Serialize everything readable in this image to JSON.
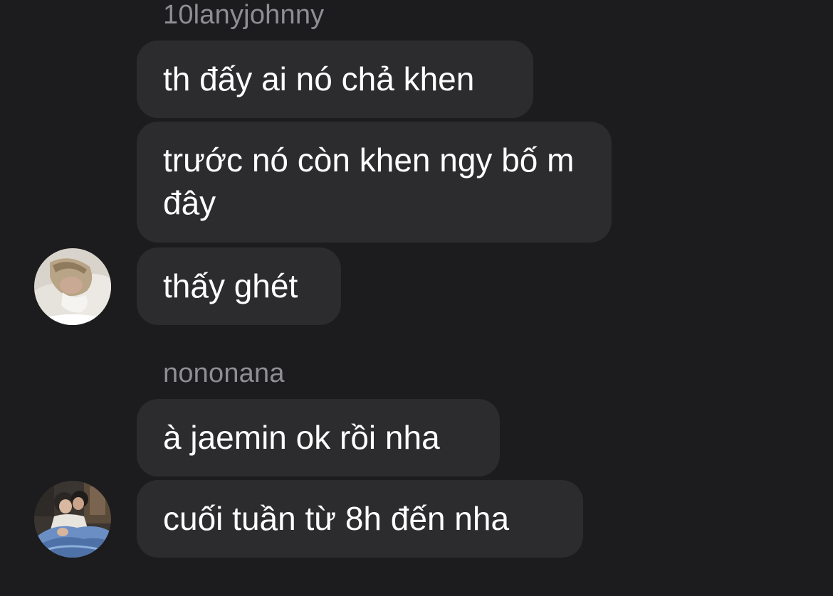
{
  "groups": [
    {
      "sender": "10lanyjohnny",
      "messages": [
        "th đấy ai nó chả khen",
        "trước nó còn khen ngy bố m đây",
        "thấy ghét"
      ],
      "avatar": "photo-avatar-blond-person-in-bed"
    },
    {
      "sender": "nononana",
      "messages": [
        "à jaemin ok rồi nha",
        "cuối tuần từ 8h đến nha"
      ],
      "avatar": "photo-avatar-two-people-blue-blanket"
    }
  ],
  "colors": {
    "background": "#1c1c1e",
    "bubble": "#2c2c2e",
    "message_text": "#ffffff",
    "sender_name": "#8e8e93"
  }
}
